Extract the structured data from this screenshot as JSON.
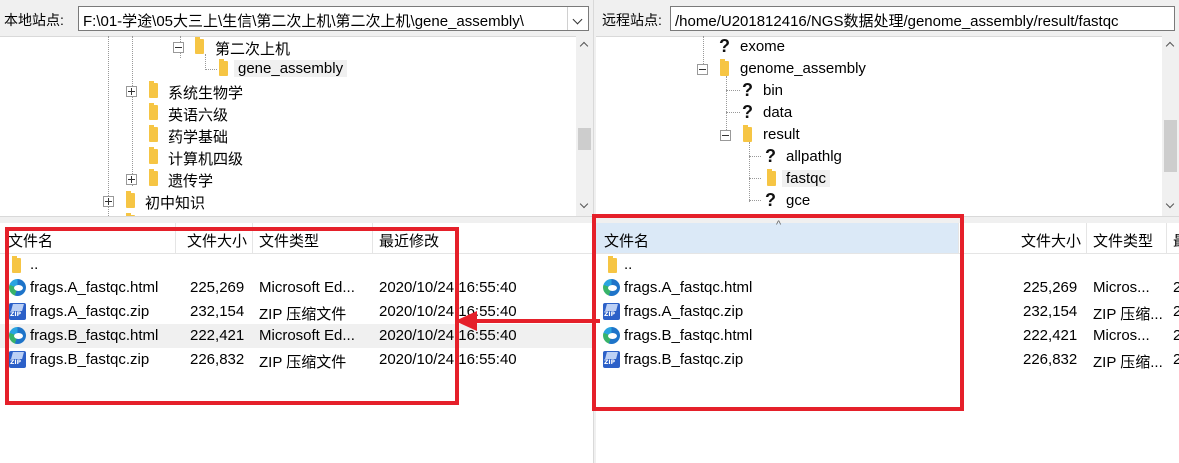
{
  "local": {
    "site_label": "本地站点:",
    "path": "F:\\01-学途\\05大三上\\生信\\第二次上机\\第二次上机\\gene_assembly\\",
    "tree": [
      {
        "label": "第二次上机"
      },
      {
        "label": "gene_assembly"
      },
      {
        "label": "系统生物学"
      },
      {
        "label": "英语六级"
      },
      {
        "label": "药学基础"
      },
      {
        "label": "计算机四级"
      },
      {
        "label": "遗传学"
      },
      {
        "label": "初中知识"
      }
    ],
    "columns": [
      "文件名",
      "文件大小",
      "文件类型",
      "最近修改"
    ],
    "parent": "..",
    "files": [
      {
        "name": "frags.A_fastqc.html",
        "size": "225,269",
        "type": "Microsoft Ed...",
        "modified": "2020/10/24 16:55:40",
        "icon": "edge-html-icon"
      },
      {
        "name": "frags.A_fastqc.zip",
        "size": "232,154",
        "type": "ZIP 压缩文件",
        "modified": "2020/10/24 16:55:40",
        "icon": "zip-icon"
      },
      {
        "name": "frags.B_fastqc.html",
        "size": "222,421",
        "type": "Microsoft Ed...",
        "modified": "2020/10/24 16:55:40",
        "icon": "edge-html-icon"
      },
      {
        "name": "frags.B_fastqc.zip",
        "size": "226,832",
        "type": "ZIP 压缩文件",
        "modified": "2020/10/24 16:55:40",
        "icon": "zip-icon"
      }
    ]
  },
  "remote": {
    "site_label": "远程站点:",
    "path": "/home/U201812416/NGS数据处理/genome_assembly/result/fastqc",
    "tree": [
      {
        "label": "exome"
      },
      {
        "label": "genome_assembly"
      },
      {
        "label": "bin"
      },
      {
        "label": "data"
      },
      {
        "label": "result"
      },
      {
        "label": "allpathlg"
      },
      {
        "label": "fastqc"
      },
      {
        "label": "gce"
      }
    ],
    "columns": [
      "文件名",
      "文件大小",
      "文件类型",
      "最"
    ],
    "parent": "..",
    "files": [
      {
        "name": "frags.A_fastqc.html",
        "size": "225,269",
        "type": "Micros...",
        "modified": "2",
        "icon": "edge-html-icon"
      },
      {
        "name": "frags.A_fastqc.zip",
        "size": "232,154",
        "type": "ZIP 压缩...",
        "modified": "2",
        "icon": "zip-icon"
      },
      {
        "name": "frags.B_fastqc.html",
        "size": "222,421",
        "type": "Micros...",
        "modified": "2",
        "icon": "edge-html-icon"
      },
      {
        "name": "frags.B_fastqc.zip",
        "size": "226,832",
        "type": "ZIP 压缩...",
        "modified": "2",
        "icon": "zip-icon"
      }
    ]
  },
  "colors": {
    "annotation": "#e5202a",
    "folder": "#f6c544",
    "selection": "#dbe9f7"
  }
}
